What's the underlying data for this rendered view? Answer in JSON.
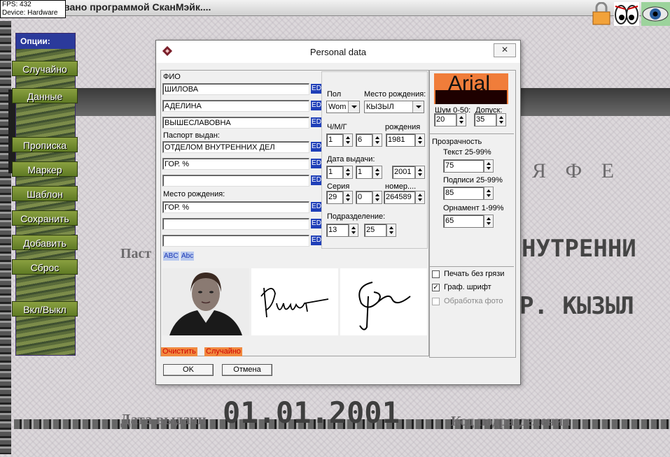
{
  "app": {
    "title": "…ровано программой СканМэйк....",
    "fps_label": "FPS: 432",
    "device_label": "Device: Hardware"
  },
  "background": {
    "row1": "Я      Ф    Е",
    "passport_label": "Паст",
    "issued_by_fragment": "НУТРЕННИ",
    "place_fragment": "Р.   КЫЗЫЛ",
    "issue_date_label": "Дата выдачи",
    "issue_date_value": "01.01.2001",
    "division_label": "Код подразделения"
  },
  "menu": {
    "header": "Опции:",
    "items": [
      "Случайно",
      "Данные",
      "Прописка",
      "Маркер",
      "Шаблон",
      "Сохранить",
      "Добавить",
      "Сброс",
      "Вкл/Выкл"
    ]
  },
  "dialog": {
    "title": "Personal data",
    "close_label": "✕",
    "fio_label": "ФИО",
    "surname": "ШИЛОВА",
    "name": "АДЕЛИНА",
    "patronymic": "ВЫШЕСЛАВОВНА",
    "issued_label": "Паспорт выдан:",
    "issued_1": "ОТДЕЛОМ ВНУТРЕННИХ ДЕЛ",
    "issued_2": "ГОР. %",
    "issued_3": "",
    "birthplace_label": "Место рождения:",
    "birthplace_1": "ГОР. %",
    "birthplace_2": "",
    "birthplace_3": "",
    "ed_label": "ED",
    "abc_upper": "ABC",
    "abc_mixed": "Abc",
    "clear_label": "Очистить",
    "random_label": "Случайно",
    "ok_label": "OK",
    "cancel_label": "Отмена",
    "gender_label": "Пол",
    "gender_value": "Wom",
    "birthplace_combo_label": "Место рождения:",
    "birthplace_combo_value": "КЫЗЫЛ",
    "dmy_label": "Ч/М/Г",
    "birth_label": "рождения",
    "birth_day": "1",
    "birth_month": "6",
    "birth_year": "1981",
    "issue_date_label": "Дата выдачи:",
    "issue_day": "1",
    "issue_month": "1",
    "issue_year": "2001",
    "series_label": "Серия",
    "number_label": "номер....",
    "series_1": "29",
    "series_2": "0",
    "number": "264589",
    "division_label": "Подразделение:",
    "division_1": "13",
    "division_2": "25",
    "font_name": "Arial",
    "noise_label": "Шум 0-50:",
    "tolerance_label": "Допуск:",
    "noise_value": "20",
    "tolerance_value": "35",
    "transparency_label": "Прозрачность",
    "text_label": "Текст 25-99%",
    "text_value": "75",
    "sign_label": "Подписи 25-99%",
    "sign_value": "85",
    "ornament_label": "Орнамент 1-99%",
    "ornament_value": "65",
    "print_clean_label": "Печать без грязи",
    "graph_font_label": "Граф. шрифт",
    "photo_proc_label": "Обработка фото",
    "print_clean_checked": false,
    "graph_font_checked": true,
    "photo_proc_checked": false
  }
}
